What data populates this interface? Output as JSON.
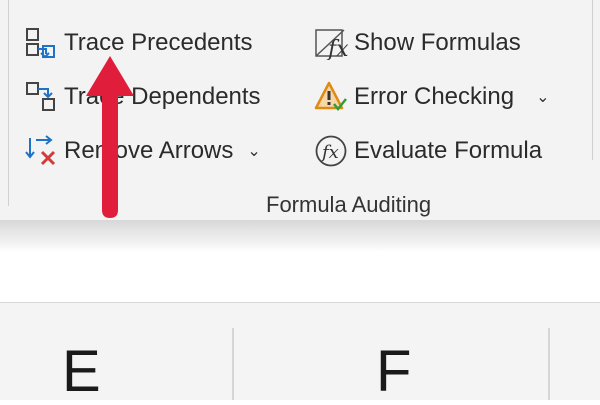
{
  "ribbon": {
    "group_label": "Formula Auditing",
    "commands": {
      "trace_precedents": "Trace Precedents",
      "trace_dependents": "Trace Dependents",
      "remove_arrows": "Remove Arrows",
      "show_formulas": "Show Formulas",
      "error_checking": "Error Checking",
      "evaluate_formula": "Evaluate Formula"
    },
    "icons": {
      "trace_precedents": "trace-precedents-icon",
      "trace_dependents": "trace-dependents-icon",
      "remove_arrows": "remove-arrows-icon",
      "show_formulas": "show-formulas-icon",
      "error_checking": "error-checking-icon",
      "evaluate_formula": "evaluate-formula-icon"
    }
  },
  "grid": {
    "column_headers": [
      "E",
      "F"
    ]
  },
  "annotation": {
    "arrow_color": "#e11d3c"
  },
  "colors": {
    "icon_blue": "#1e73c8",
    "icon_red": "#d33a3a",
    "warning_orange": "#e08a16"
  }
}
